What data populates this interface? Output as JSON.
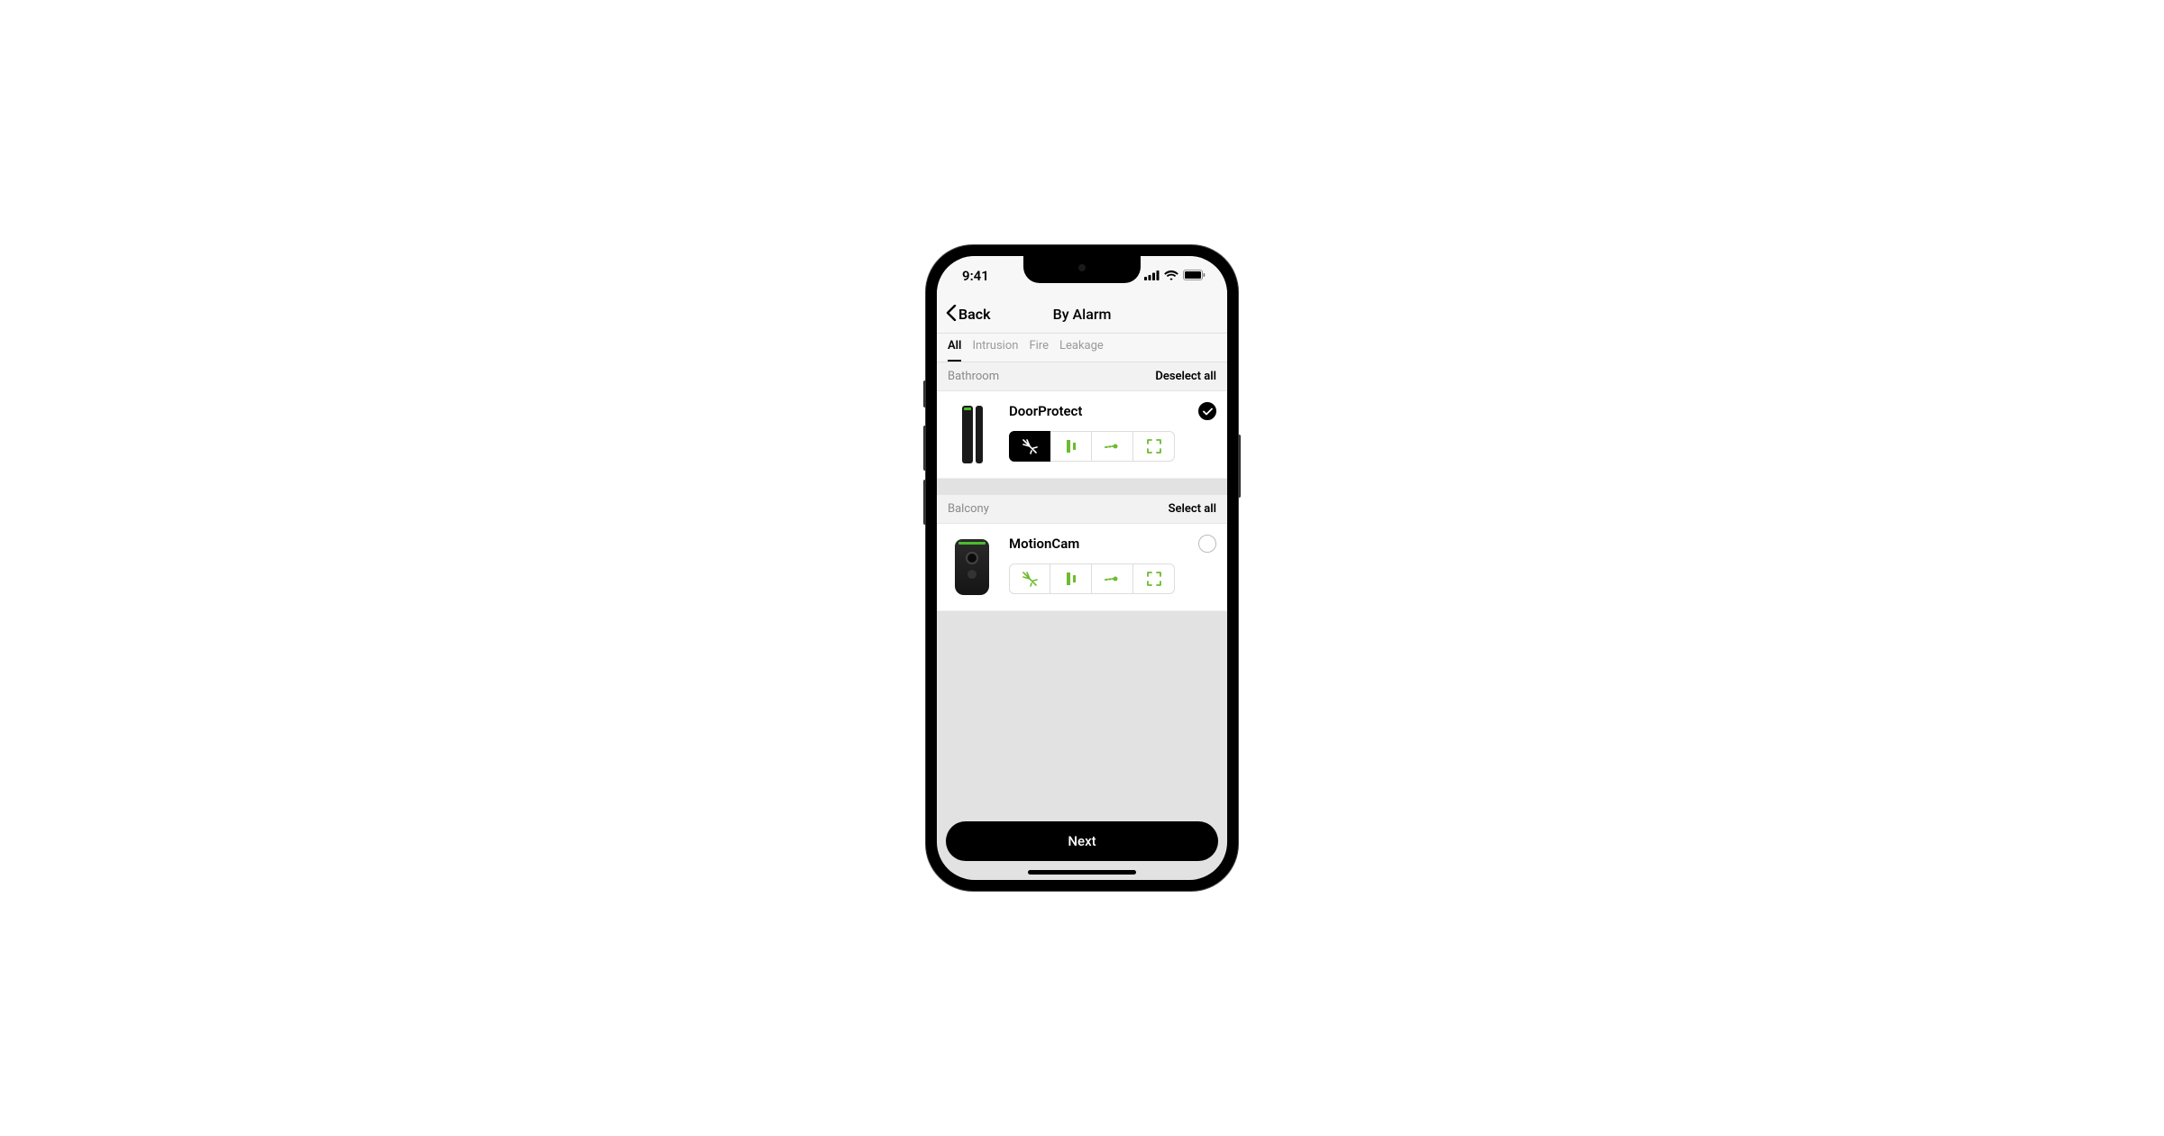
{
  "status": {
    "time": "9:41"
  },
  "nav": {
    "back": "Back",
    "title": "By Alarm"
  },
  "tabs": [
    {
      "label": "All",
      "active": true
    },
    {
      "label": "Intrusion",
      "active": false
    },
    {
      "label": "Fire",
      "active": false
    },
    {
      "label": "Leakage",
      "active": false
    }
  ],
  "sections": [
    {
      "name": "Bathroom",
      "action": "Deselect all",
      "devices": [
        {
          "name": "DoorProtect",
          "selected": true,
          "attrActive": 0,
          "kind": "doorprotect"
        }
      ]
    },
    {
      "name": "Balcony",
      "action": "Select all",
      "devices": [
        {
          "name": "MotionCam",
          "selected": false,
          "attrActive": -1,
          "kind": "motioncam"
        }
      ]
    }
  ],
  "attr_icons": [
    "intrusion-icon",
    "tamper-icon",
    "glass-icon",
    "expand-icon"
  ],
  "footer": {
    "next": "Next"
  }
}
